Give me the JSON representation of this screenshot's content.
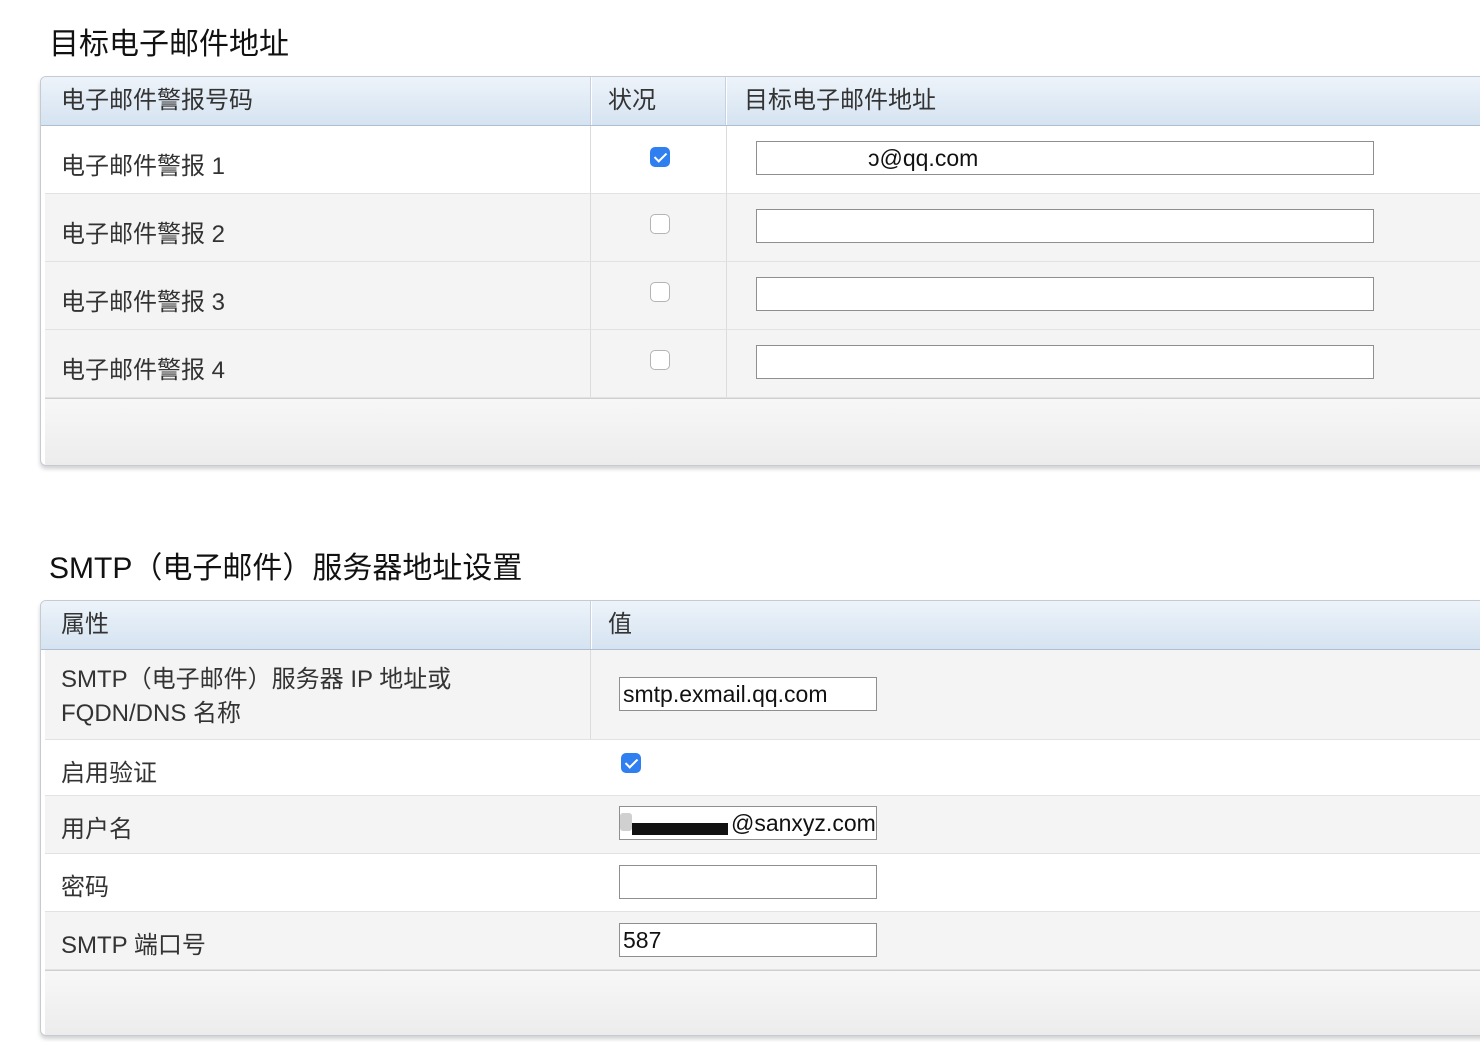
{
  "alerts_section": {
    "title": "目标电子邮件地址",
    "headers": {
      "number": "电子邮件警报号码",
      "status": "状况",
      "address": "目标电子邮件地址"
    },
    "rows": [
      {
        "label": "电子邮件警报 1",
        "enabled": true,
        "address": "@qq.com",
        "address_prefix_visible": "ↄ"
      },
      {
        "label": "电子邮件警报 2",
        "enabled": false,
        "address": ""
      },
      {
        "label": "电子邮件警报 3",
        "enabled": false,
        "address": ""
      },
      {
        "label": "电子邮件警报 4",
        "enabled": false,
        "address": ""
      }
    ]
  },
  "smtp_section": {
    "title": "SMTP（电子邮件）服务器地址设置",
    "headers": {
      "property": "属性",
      "value": "值"
    },
    "rows": {
      "server": {
        "label_line1": "SMTP（电子邮件）服务器 IP 地址或",
        "label_line2": "FQDN/DNS 名称",
        "value": "smtp.exmail.qq.com"
      },
      "auth": {
        "label": "启用验证",
        "enabled": true
      },
      "username": {
        "label": "用户名",
        "value": "@sanxyz.com"
      },
      "password": {
        "label": "密码",
        "value": ""
      },
      "port": {
        "label": "SMTP 端口号",
        "value": "587"
      }
    }
  },
  "colors": {
    "checkbox_checked": "#2f7ff0",
    "header_gradient_top": "#edf3fa",
    "header_gradient_bottom": "#d5e3f1",
    "row_alt": "#f4f4f4"
  }
}
